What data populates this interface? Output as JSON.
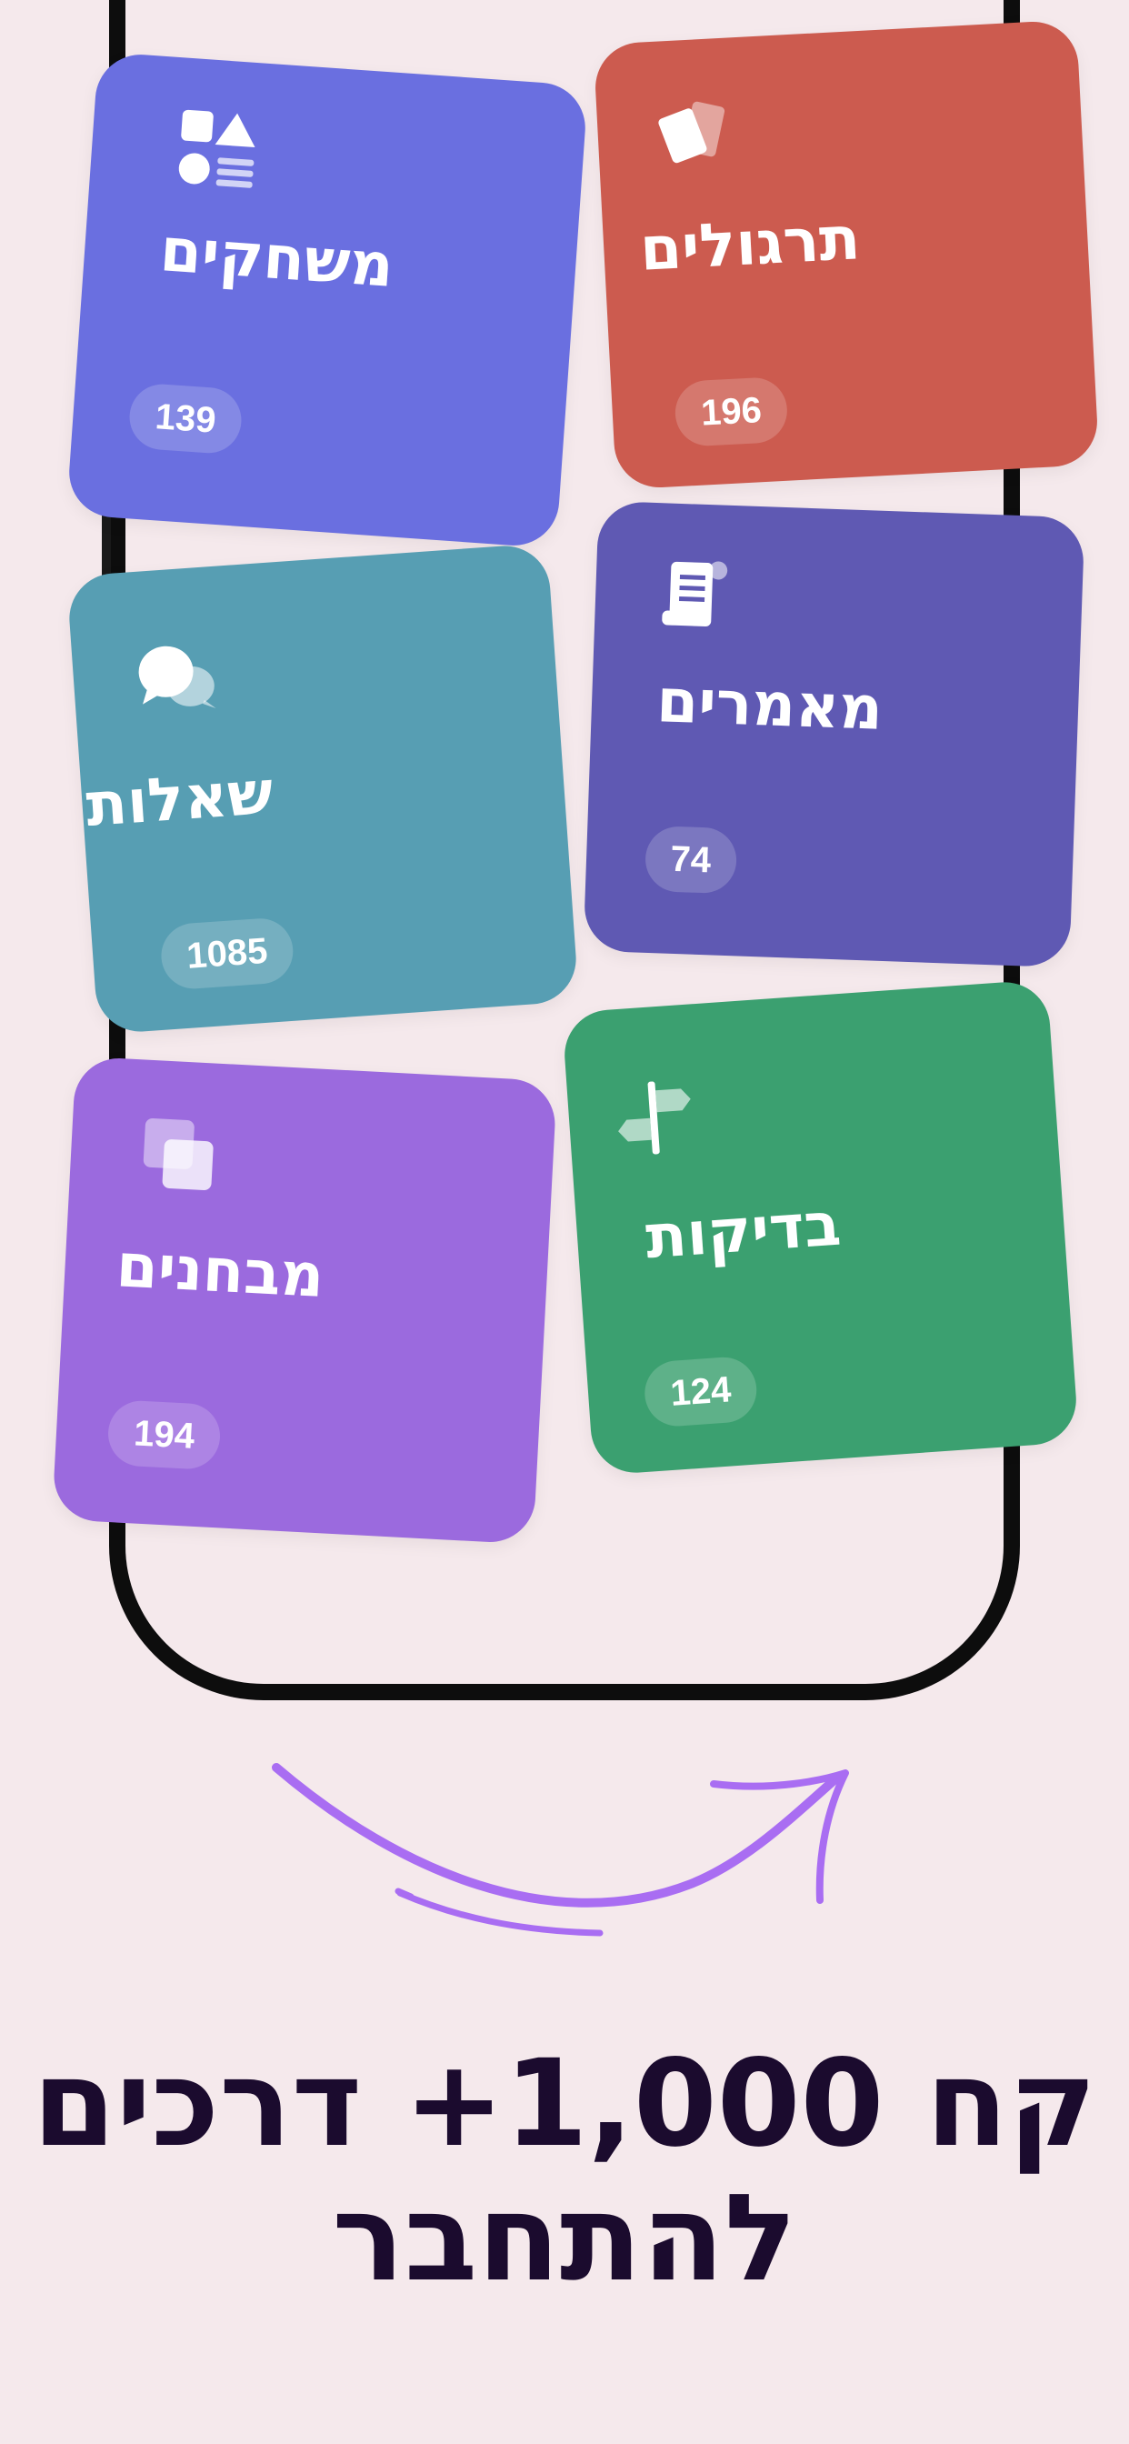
{
  "cards": {
    "games": {
      "title": "משחקים",
      "count": "139",
      "color": "#6A6FE0",
      "icon": "shapes-icon"
    },
    "practice": {
      "title": "תרגולים",
      "count": "196",
      "color": "#CC5B4F",
      "icon": "cards-icon"
    },
    "questions": {
      "title": "שאלות",
      "count": "1085",
      "color": "#579EB3",
      "icon": "chat-bubbles-icon"
    },
    "articles": {
      "title": "מאמרים",
      "count": "74",
      "color": "#5F59B3",
      "icon": "scroll-icon"
    },
    "quizzes": {
      "title": "מבחנים",
      "count": "194",
      "color": "#9B6ADE",
      "icon": "layers-icon"
    },
    "checks": {
      "title": "בדיקות",
      "count": "124",
      "color": "#3BA070",
      "icon": "signpost-icon"
    }
  },
  "headline": {
    "line1": "קח 1,000+ דרכים",
    "line2": "להתחבר"
  },
  "colors": {
    "background": "#F5E9EC",
    "arrow": "#A96DF2",
    "text": "#1B0B2E"
  }
}
